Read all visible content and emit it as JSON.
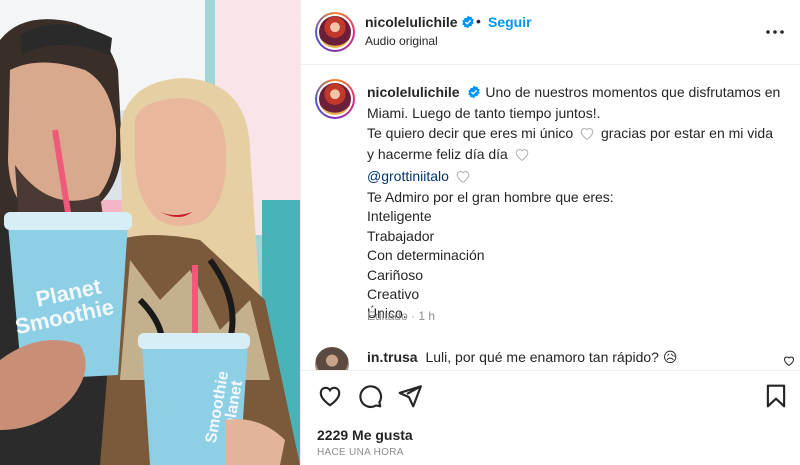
{
  "post": {
    "username": "nicolelulichile",
    "follow_label": "Seguir",
    "separator": "•",
    "audio_label": "Audio original",
    "caption": {
      "username": "nicolelulichile",
      "line1": "Uno de nuestros momentos que disfrutamos en",
      "line2": "Miami. Luego de tanto tiempo juntos!.",
      "line3a": "Te quiero decir que eres mi único",
      "line3b": "gracias por estar en mi vida",
      "line4": "y hacerme feliz día día",
      "mention": "@grottiniitalo",
      "line6": "Te Admiro por el gran hombre que eres:",
      "traits": [
        "Inteligente",
        "Trabajador",
        "Con determinación",
        "Cariñoso",
        "Creativo",
        "Único."
      ]
    },
    "caption_meta": "Editado · 1 h",
    "comment": {
      "username": "in.trusa",
      "text": "Luli, por qué me enamoro tan rápido? 😥"
    },
    "likes": "2229 Me gusta",
    "time_ago": "HACE UNA HORA"
  },
  "media": {
    "cup_brand_line1": "Planet",
    "cup_brand_line2": "Smoothie",
    "cup2_brand_line1": "planet",
    "cup2_brand_line2": "Smoothie"
  },
  "icons": {
    "verified": "verified-badge-icon",
    "more": "more-options-icon",
    "like": "heart-icon",
    "comment": "comment-icon",
    "share": "share-icon",
    "save": "bookmark-icon"
  },
  "colors": {
    "accent": "#0095f6",
    "mention": "#00376b",
    "muted": "#8e8e8e",
    "text": "#262626"
  }
}
